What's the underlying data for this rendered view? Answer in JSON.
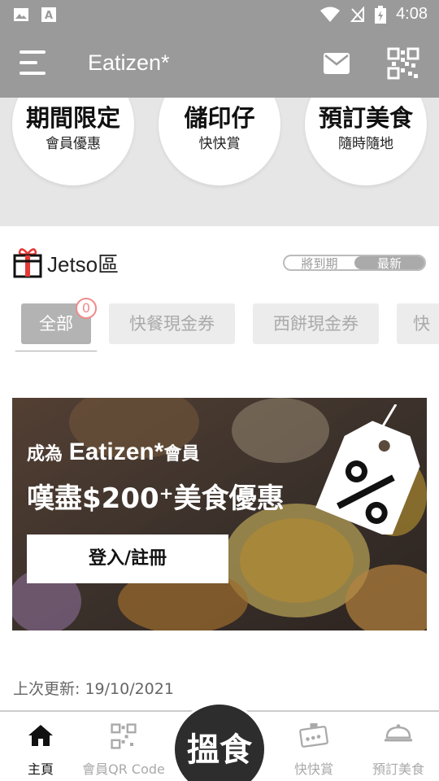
{
  "status_bar": {
    "time": "4:08",
    "icons": [
      "image-icon",
      "text-a-icon",
      "wifi-icon",
      "no-signal-icon",
      "battery-charging-icon"
    ]
  },
  "app_bar": {
    "title": "Eatizen*",
    "icons": [
      "menu-icon",
      "mail-icon",
      "qr-code-icon"
    ]
  },
  "promos": [
    {
      "title": "期間限定",
      "subtitle": "會員優惠",
      "icon": "stopwatch-icon"
    },
    {
      "title": "儲印仔",
      "subtitle": "快快賞",
      "icon": "stamp-card-icon"
    },
    {
      "title": "預訂美食",
      "subtitle": "隨時隨地",
      "icon": "food-cloche-icon"
    }
  ],
  "jetso": {
    "title": "Jetso區",
    "icon": "gift-icon",
    "sort_options": [
      "將到期",
      "最新"
    ],
    "sort_selected": "最新"
  },
  "tabs": {
    "items": [
      "全部",
      "快餐現金券",
      "西餅現金券",
      "快"
    ],
    "selected": "全部",
    "badge_count": "0"
  },
  "banner": {
    "line1_prefix": "成為",
    "line1_brand": "Eatizen*",
    "line1_suffix": "會員",
    "line2": "嘆盡$200⁺美食優惠",
    "button": "登入/註冊",
    "icon": "discount-tag-icon"
  },
  "last_update": "上次更新: 19/10/2021",
  "bottom_nav": {
    "items": [
      {
        "label": "主頁",
        "icon": "home-icon"
      },
      {
        "label": "會員QR Code",
        "icon": "qr-code-icon"
      },
      {
        "label": "快快賞",
        "icon": "stamp-card-icon"
      },
      {
        "label": "預訂美食",
        "icon": "food-cloche-icon"
      }
    ],
    "center_label": "搵食",
    "active": "主頁"
  },
  "colors": {
    "app_bar": "#9a9a9a",
    "strip_bg": "#e6e6e6",
    "tab_active": "#b3b3b3",
    "tab_inactive": "#ececec",
    "badge": "#f08a8a",
    "center_button": "#2d2d2d"
  }
}
